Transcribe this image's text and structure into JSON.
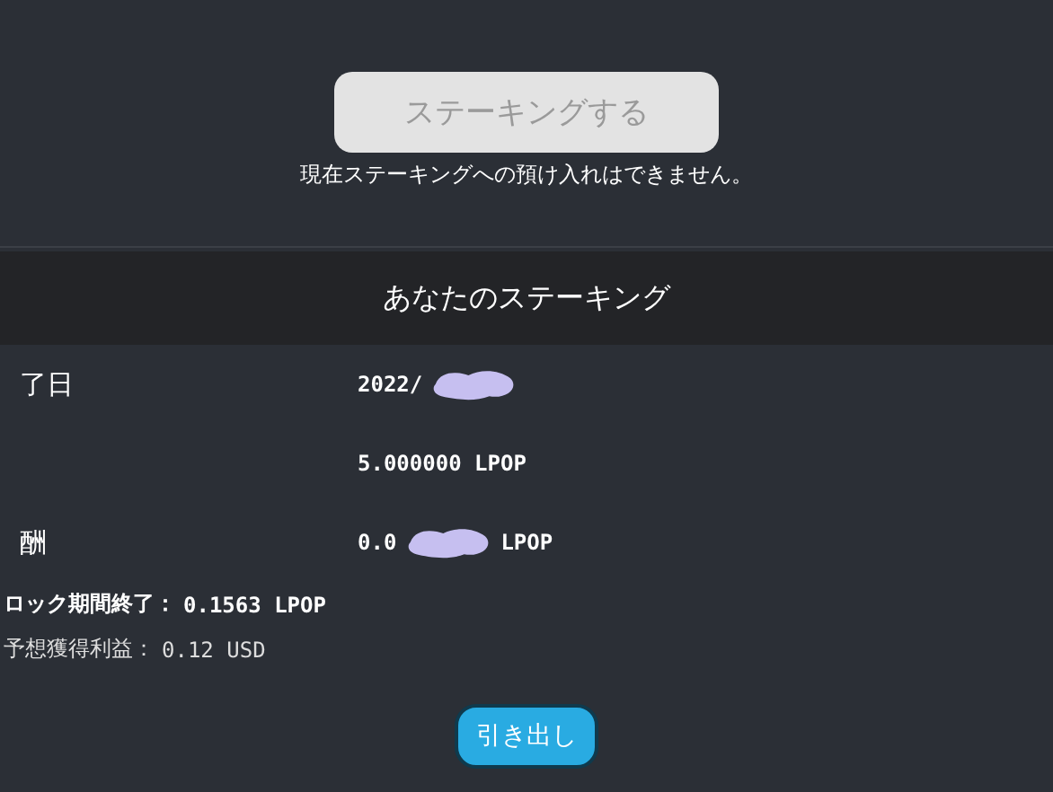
{
  "stake_button": {
    "label": "ステーキングする",
    "disabled": true
  },
  "notice": "現在ステーキングへの預け入れはできません。",
  "panel": {
    "title": "あなたのステーキング",
    "rows": [
      {
        "label": "了日",
        "value": "2022/",
        "redacted": true,
        "suffix": ""
      },
      {
        "value": "5.000000 LPOP",
        "redacted": false,
        "suffix": ""
      },
      {
        "label": "酬",
        "value": "0.0",
        "redacted": true,
        "suffix": "LPOP"
      }
    ],
    "lines": [
      {
        "label": "ロック期間終了：",
        "value": "0.1563 LPOP",
        "bold": true
      },
      {
        "label": "予想獲得利益：",
        "value": "0.12 USD",
        "bold": false
      }
    ],
    "withdraw_button": "引き出し"
  }
}
